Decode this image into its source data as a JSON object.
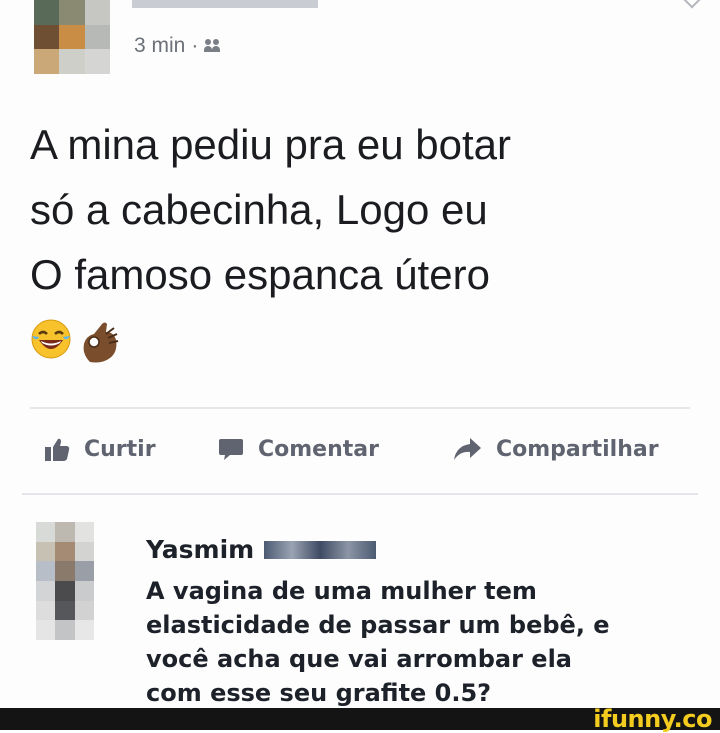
{
  "post": {
    "time": "3 min",
    "separator": "·",
    "audience_icon": "friends-icon",
    "text_lines": [
      "A mina pediu pra eu botar",
      "só a cabecinha, Logo eu",
      "O famoso espanca útero"
    ],
    "emojis": [
      "face-with-tears-of-joy",
      "ok-hand"
    ]
  },
  "actions": {
    "like_label": "Curtir",
    "comment_label": "Comentar",
    "share_label": "Compartilhar",
    "icons": [
      "thumbs-up-icon",
      "speech-bubble-icon",
      "share-arrow-icon"
    ]
  },
  "comment": {
    "author": "Yasmim",
    "text_lines": [
      "A vagina de uma mulher tem",
      "elasticidade de passar um bebê, e",
      "você acha que vai arrombar ela",
      "com esse seu grafite 0.5?"
    ]
  },
  "watermark": {
    "text": "ifunny.co"
  },
  "colors": {
    "action_gray": "#5f6470",
    "logo_yellow": "#f3cc1f",
    "footer": "#141414"
  }
}
